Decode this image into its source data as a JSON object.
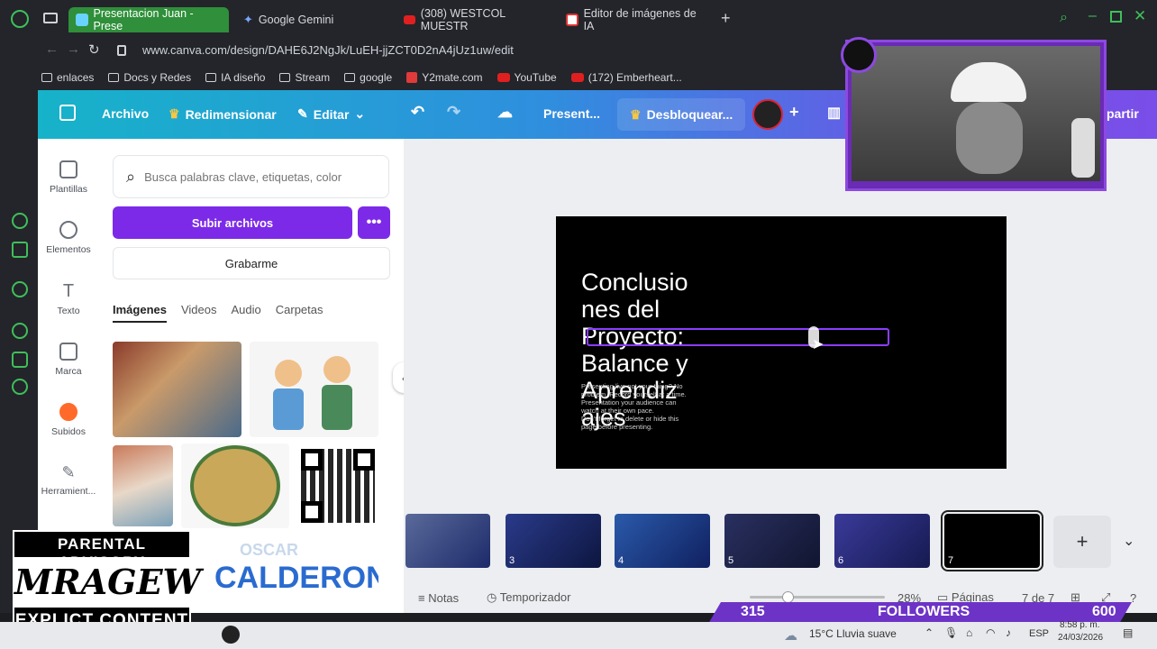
{
  "browser": {
    "tabs": [
      {
        "label": "Presentacion Juan - Prese",
        "active": true
      },
      {
        "label": "Google Gemini"
      },
      {
        "label": "(308) WESTCOL MUESTR"
      },
      {
        "label": "Editor de imágenes de IA"
      }
    ],
    "url": "www.canva.com/design/DAHE6J2NgJk/LuEH-jjZCT0D2nA4jUz1uw/edit",
    "bookmarks": [
      "enlaces",
      "Docs y Redes",
      "IA diseño",
      "Stream",
      "google",
      "Y2mate.com",
      "YouTube",
      "(172) Emberheart..."
    ]
  },
  "header": {
    "archivo": "Archivo",
    "redimensionar": "Redimensionar",
    "editar": "Editar",
    "presentar": "Present...",
    "desbloquear": "Desbloquear...",
    "compartir": "partir"
  },
  "nav": [
    "Plantillas",
    "Elementos",
    "Texto",
    "Marca",
    "Subidos",
    "Herramient..."
  ],
  "panel": {
    "search_placeholder": "Busca palabras clave, etiquetas, color",
    "upload": "Subir archivos",
    "more": "•••",
    "record": "Grabarme",
    "tabs": [
      "Imágenes",
      "Videos",
      "Audio",
      "Carpetas"
    ],
    "calderon_text": "CALDERON",
    "oscar_text": "OSCAR"
  },
  "slide": {
    "title": "Conclusiones del Proyecto: Balance y Aprendizajes",
    "title_lines": [
      "Conclusio",
      "nes del",
      "Proyecto:",
      "Balance y",
      "Aprendiz",
      "ajes"
    ],
    "body_lines": [
      "Presenting live not your thing? No",
      "problem. Record yourself at a time.",
      "Presentation your audience can",
      "watch at their own pace.",
      "Don't forget to delete or hide this",
      "page before presenting."
    ]
  },
  "pages": [
    {
      "num": "",
      "color": "#3b4a7a"
    },
    {
      "num": "3",
      "color": "#1d2a6a"
    },
    {
      "num": "4",
      "color": "#23408a"
    },
    {
      "num": "5",
      "color": "#202a55"
    },
    {
      "num": "6",
      "color": "#2a2f7a"
    },
    {
      "num": "7",
      "color": "#000000",
      "selected": true
    }
  ],
  "bottom": {
    "notas": "Notas",
    "temporizador": "Temporizador",
    "zoom": "28%",
    "paginas": "Páginas",
    "page_count": "7 de 7"
  },
  "overlay": {
    "parental_top": "PARENTAL ADVISORY",
    "logo_text": "MRAGEW",
    "parental_bottom": "EXPLICT CONTENT",
    "followers_count": "315",
    "followers_label": "FOLLOWERS",
    "followers_goal": "600"
  },
  "taskbar": {
    "weather": "15°C Lluvia suave",
    "lang": "ESP",
    "time": "8:58 p. m.",
    "date": "24/03/2026"
  }
}
